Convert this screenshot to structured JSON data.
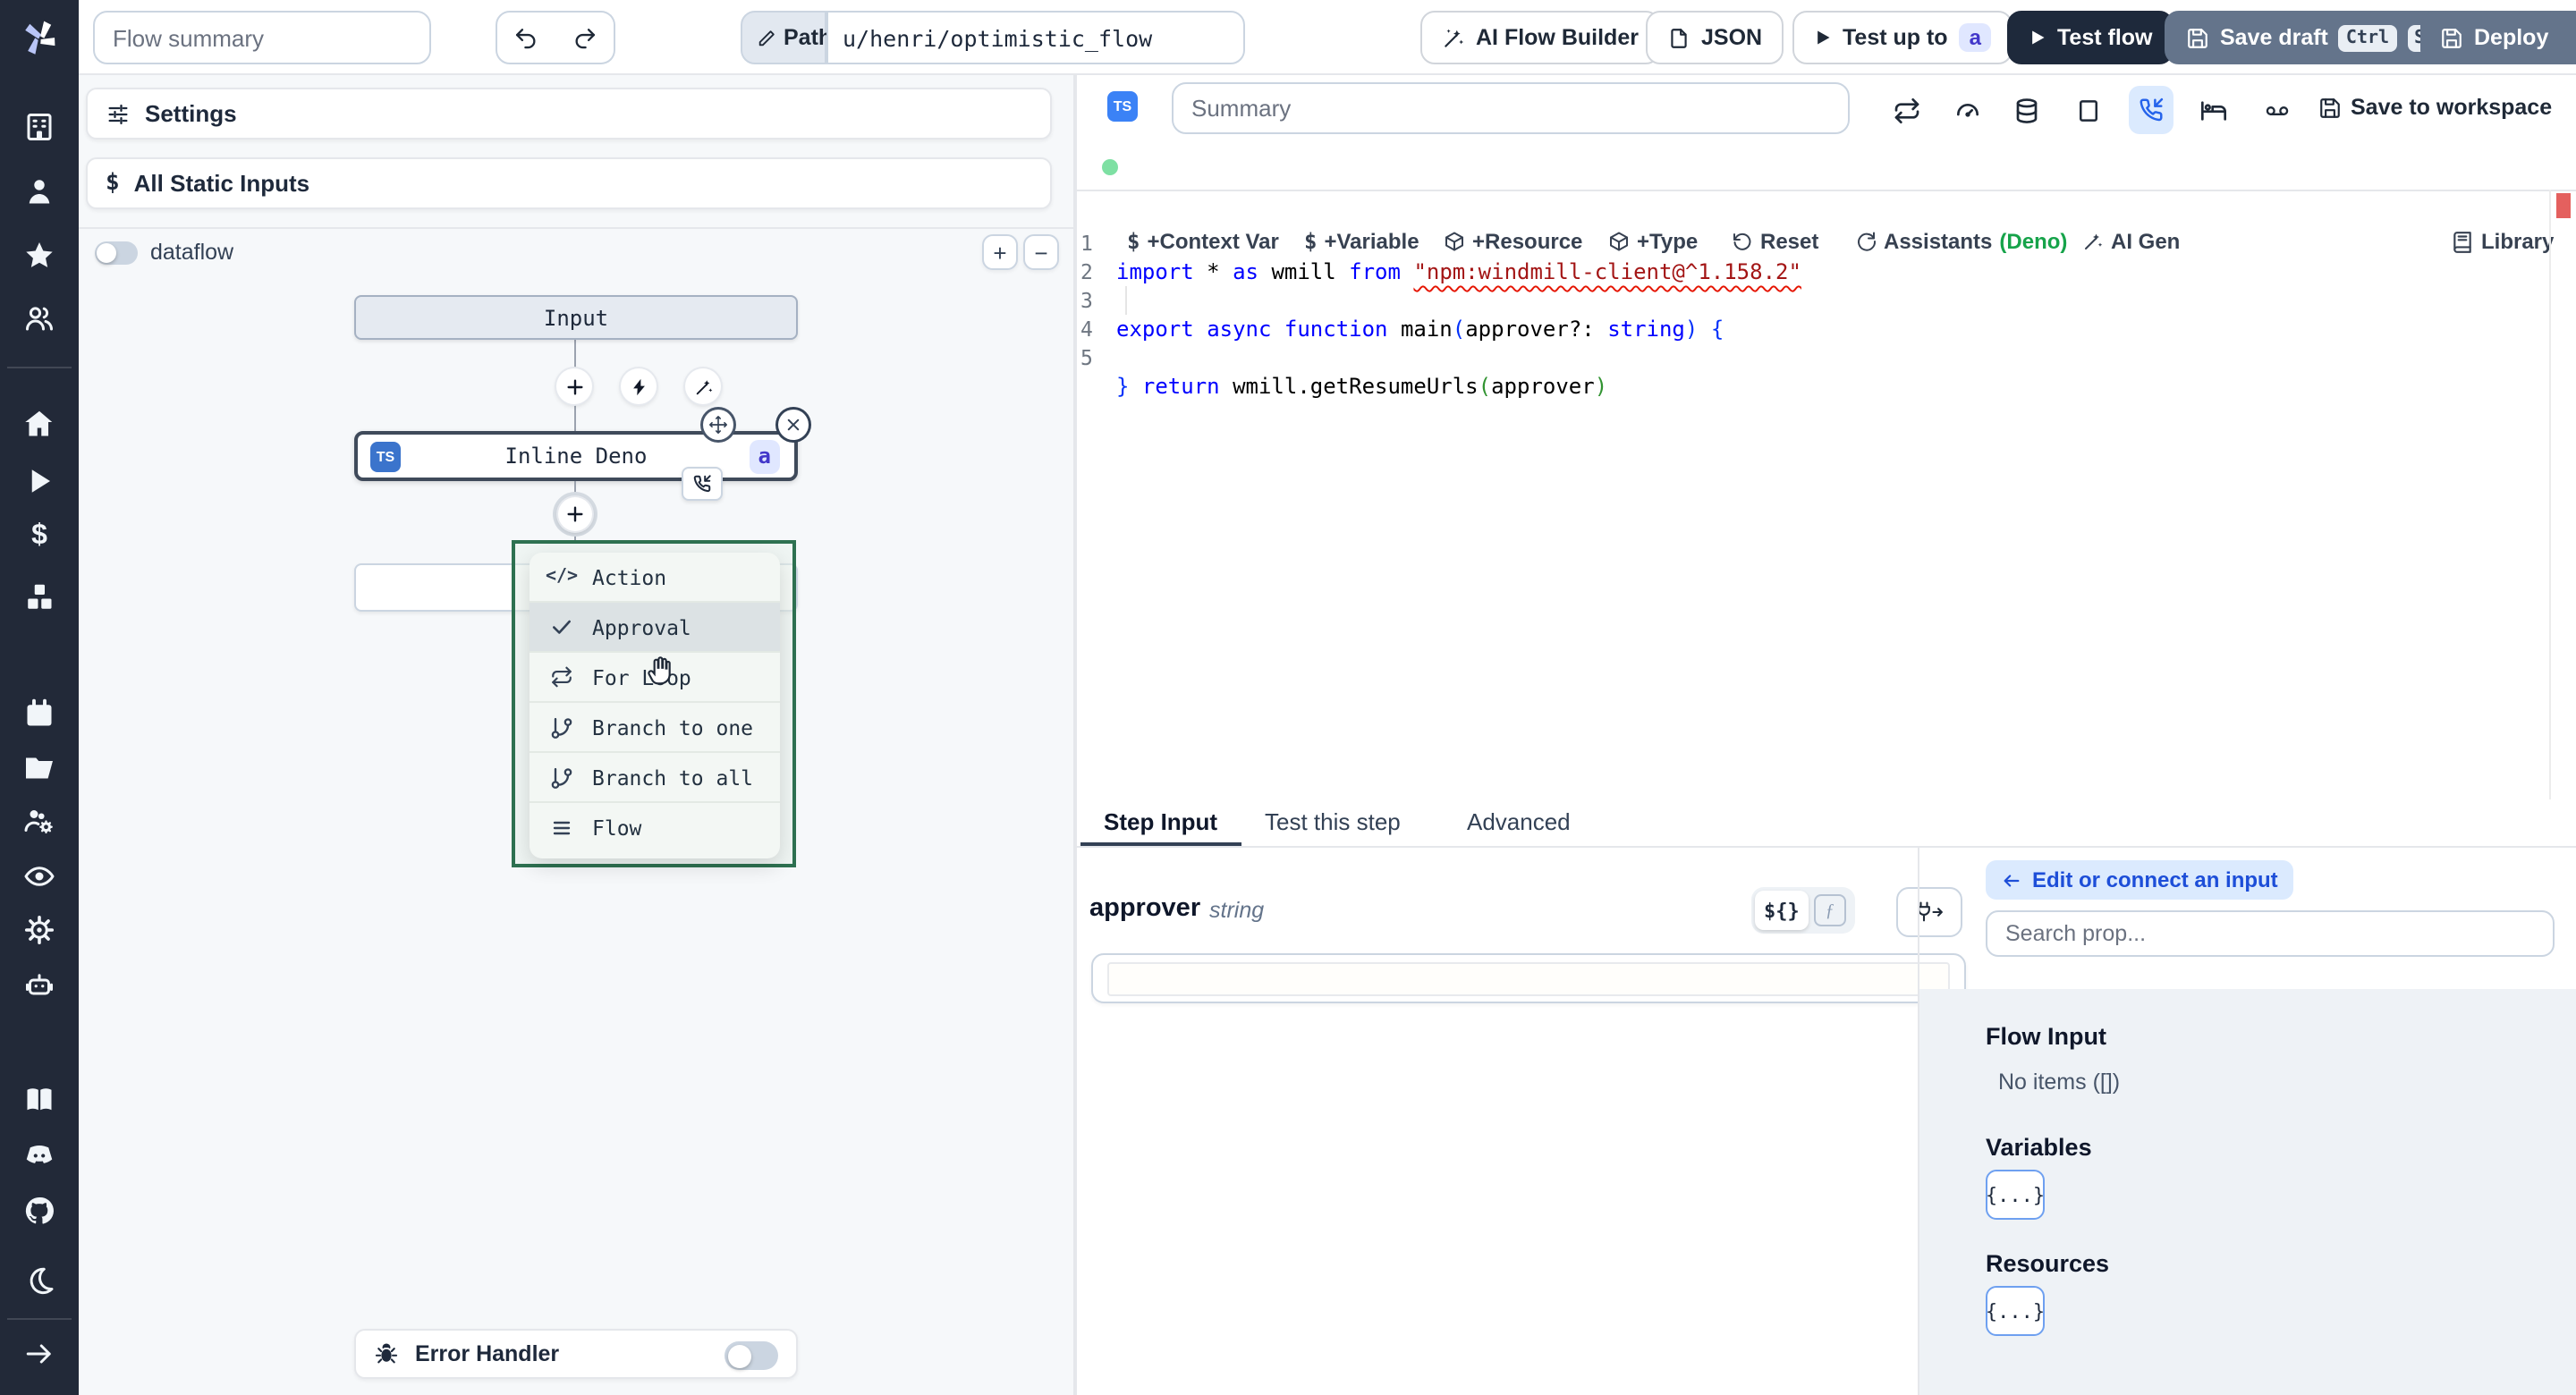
{
  "glyphs": {
    "dollar": "$",
    "code_tag": "</>"
  },
  "topbar": {
    "flow_summary_placeholder": "Flow summary",
    "path_label": "Path",
    "path_value": "u/henri/optimistic_flow",
    "ai_flow_builder_label": "AI Flow Builder",
    "json_label": "JSON",
    "test_up_to_label": "Test up to",
    "test_up_to_badge": "a",
    "test_flow_label": "Test flow",
    "save_draft_label": "Save draft",
    "kbd_ctrl": "Ctrl",
    "kbd_s": "S",
    "deploy_label": "Deploy"
  },
  "sidebar": {
    "icon_names": [
      "windmill-logo",
      "workspace-building",
      "user",
      "star-favorites",
      "users-groups",
      "home",
      "runs-play",
      "variables-dollar",
      "resources-cubes",
      "schedules-calendar",
      "folders",
      "groups-admin",
      "audit-logs-eye",
      "settings-gear",
      "workers-robot",
      "docs-book",
      "discord",
      "github",
      "dark-mode-moon",
      "collapse-sidebar-arrow"
    ]
  },
  "flow_panel": {
    "settings_label": "Settings",
    "all_static_inputs_label": "All Static Inputs",
    "dataflow_label": "dataflow",
    "zoom_in": "+",
    "zoom_out": "−",
    "input_node_label": "Input",
    "step_node": {
      "lang_badge": "TS",
      "label": "Inline Deno",
      "suspend_badge": "a"
    },
    "insert_menu": {
      "items": [
        {
          "label": "Action"
        },
        {
          "label": "Approval"
        },
        {
          "label": "For Loop"
        },
        {
          "label": "Branch to one"
        },
        {
          "label": "Branch to all"
        },
        {
          "label": "Flow"
        }
      ]
    },
    "error_handler_label": "Error Handler"
  },
  "editor": {
    "lang_badge": "TS",
    "summary_placeholder": "Summary",
    "save_to_workspace_label": "Save to workspace",
    "toolbar": {
      "context_var": "+Context Var",
      "variable": "+Variable",
      "resource": "+Resource",
      "type": "+Type",
      "reset": "Reset",
      "assistants": "Assistants",
      "assistants_lang": "(Deno)",
      "ai_gen": "AI Gen",
      "library": "Library"
    },
    "code": {
      "line_numbers": [
        "1",
        "2",
        "3",
        "4",
        "5"
      ],
      "lines": [
        {
          "tokens": [
            {
              "t": "import"
            },
            {
              "t": " * "
            },
            {
              "t": "as"
            },
            {
              "t": " wmill "
            },
            {
              "t": "from"
            },
            {
              "t": " "
            },
            {
              "t": "\"npm:windmill-client@^1.158.2\""
            }
          ]
        },
        {
          "tokens": []
        },
        {
          "tokens": [
            {
              "t": "export"
            },
            {
              "t": " "
            },
            {
              "t": "async"
            },
            {
              "t": " "
            },
            {
              "t": "function"
            },
            {
              "t": " main"
            },
            {
              "t": "("
            },
            {
              "t": "approver?: "
            },
            {
              "t": "string"
            },
            {
              "t": ") "
            },
            {
              "t": "{"
            }
          ]
        },
        {
          "tokens": [
            {
              "t": "  "
            },
            {
              "t": "return"
            },
            {
              "t": " wmill.getResumeUrls"
            },
            {
              "t": "("
            },
            {
              "t": "approver"
            },
            {
              "t": ")"
            }
          ]
        },
        {
          "tokens": [
            {
              "t": "}"
            }
          ]
        }
      ]
    }
  },
  "step_panel": {
    "tabs": [
      {
        "label": "Step Input"
      },
      {
        "label": "Test this step"
      },
      {
        "label": "Advanced"
      }
    ],
    "field_name": "approver",
    "field_type": "string",
    "static_toggle_label": "${}",
    "js_toggle_label": "ƒ"
  },
  "prop_panel": {
    "edit_connect_label": "Edit or connect an input",
    "search_placeholder": "Search prop...",
    "flow_input_title": "Flow Input",
    "flow_input_empty": "No items ([])",
    "variables_title": "Variables",
    "variables_chip": "{...}",
    "resources_title": "Resources",
    "resources_chip": "{...}"
  },
  "colors": {
    "sidebar_bg": "#222938",
    "dark_button": "#1e293b",
    "slate_button": "#64748b",
    "accent_blue": "#3b82f6",
    "badge_indigo_bg": "#e0e7ff",
    "badge_indigo_text": "#4338ca",
    "menu_border_green": "#2e7151",
    "deno_green": "#16a34a",
    "error_red": "#e4605e",
    "light_blue_bg": "#dbeafe",
    "blue_text": "#1d4ed8"
  }
}
